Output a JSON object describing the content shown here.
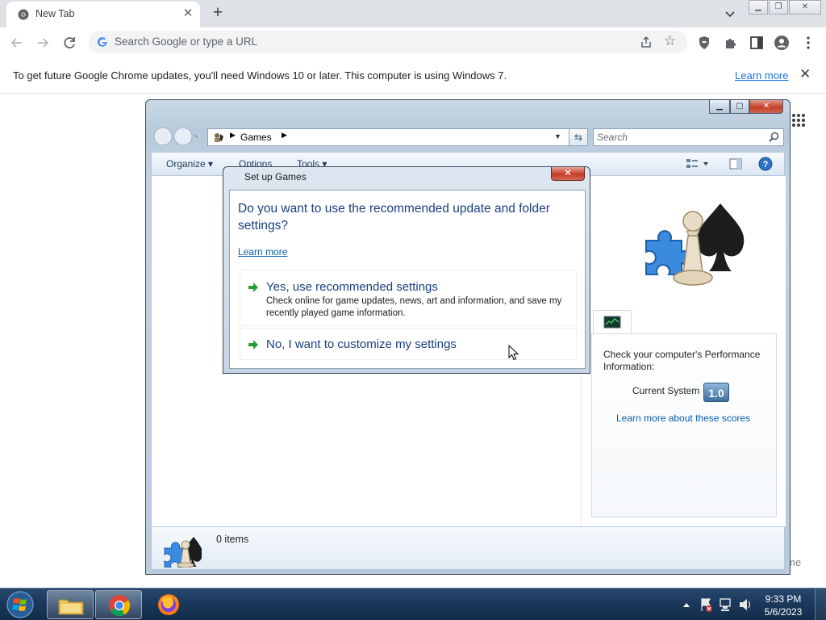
{
  "browser": {
    "tab_title": "New Tab",
    "omnibox_placeholder": "Search Google or type a URL",
    "infobar_message": "To get future Google Chrome updates, you'll need Windows 10 or later. This computer is using Windows 7.",
    "infobar_link": "Learn more",
    "page_fragment": "me"
  },
  "explorer": {
    "breadcrumb": "Games",
    "search_placeholder": "Search",
    "menu": {
      "organize": "Organize",
      "options": "Options",
      "tools": "Tools"
    },
    "performance": {
      "heading": "Check your computer's Performance Information:",
      "current_label": "Current System",
      "score": "1.0",
      "link": "Learn more about these scores"
    },
    "status": {
      "item_count": "0 items"
    }
  },
  "dialog": {
    "title": "Set up Games",
    "question": "Do you want to use the recommended update and folder settings?",
    "learn_more": "Learn more",
    "options": [
      {
        "title": "Yes, use recommended settings",
        "description": "Check online for game updates, news, art and information, and save my recently played game information."
      },
      {
        "title": "No, I want to customize my settings",
        "description": ""
      }
    ]
  },
  "taskbar": {
    "time": "9:33 PM",
    "date": "5/6/2023"
  },
  "colors": {
    "chrome_link": "#1a73e8",
    "win_link": "#0b5fab",
    "dialog_heading": "#1a3f80",
    "taskbar": "#1c3a5e"
  }
}
